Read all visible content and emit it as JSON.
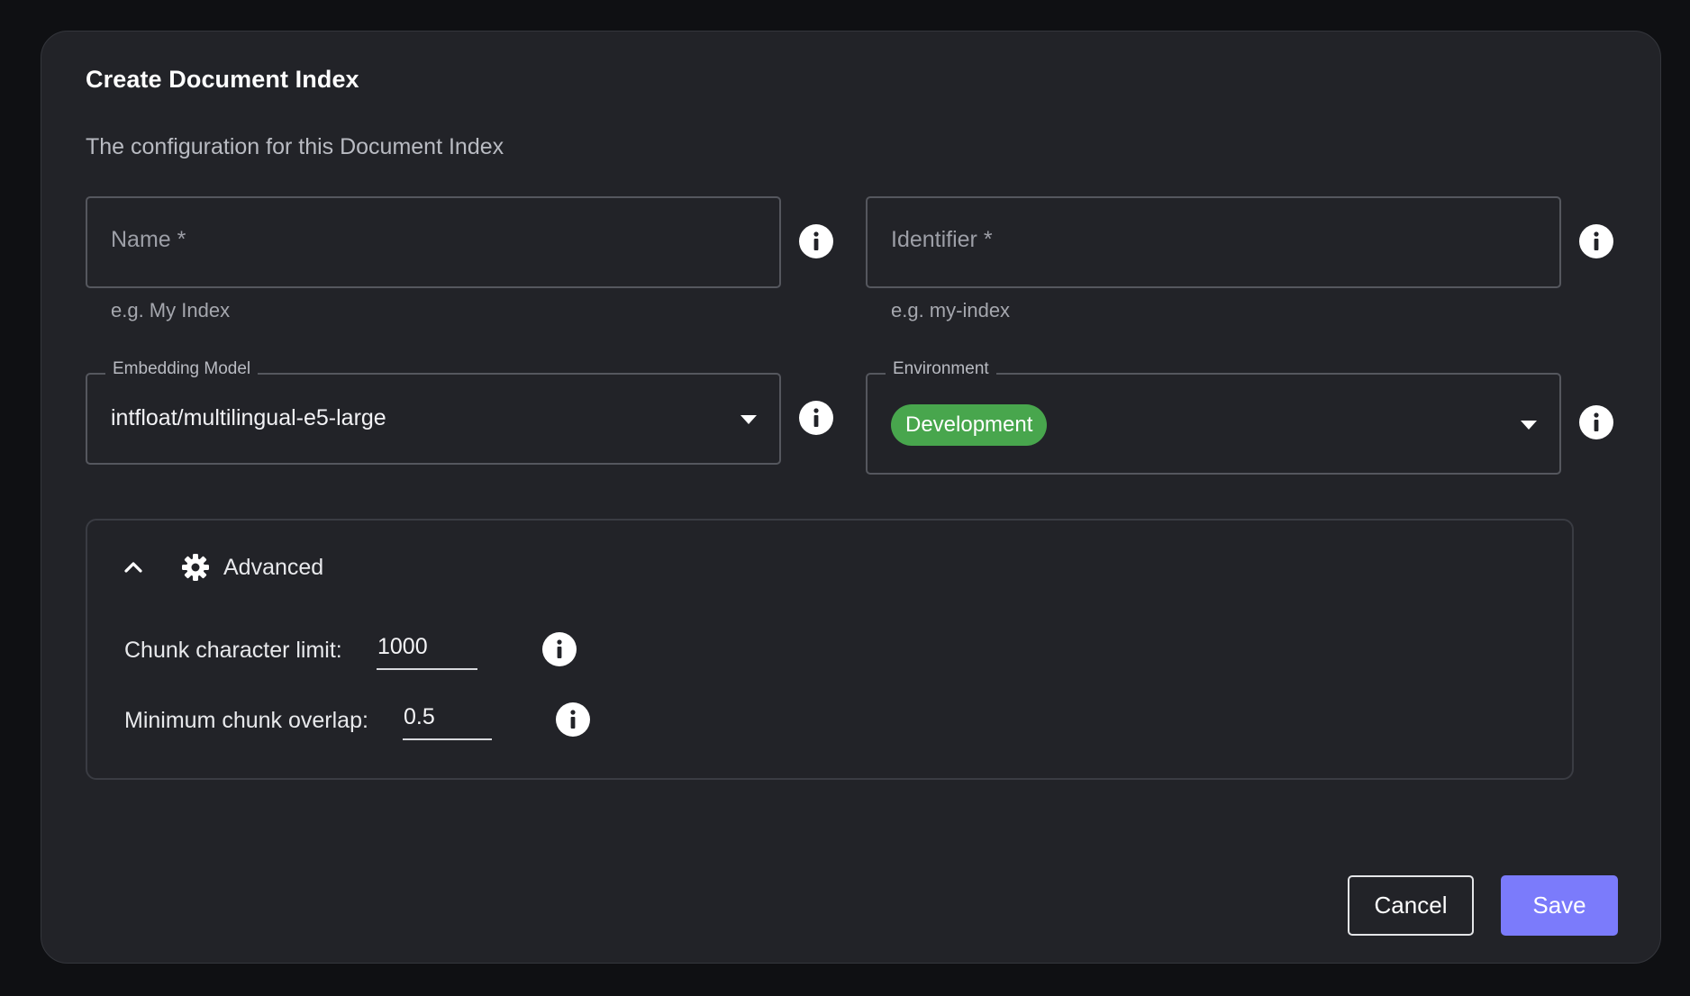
{
  "dialog": {
    "title": "Create Document Index",
    "subtitle": "The configuration for this Document Index"
  },
  "fields": {
    "name": {
      "label": "Name *",
      "value": "",
      "helper": "e.g. My Index"
    },
    "identifier": {
      "label": "Identifier *",
      "value": "",
      "helper": "e.g. my-index"
    },
    "embedding_model": {
      "label": "Embedding Model",
      "value": "intfloat/multilingual-e5-large"
    },
    "environment": {
      "label": "Environment",
      "value": "Development",
      "chip_color": "#48a64d"
    }
  },
  "advanced": {
    "label": "Advanced",
    "expanded": true,
    "chunk_limit": {
      "label": "Chunk character limit:",
      "value": "1000"
    },
    "chunk_overlap": {
      "label": "Minimum chunk overlap:",
      "value": "0.5"
    }
  },
  "actions": {
    "cancel_label": "Cancel",
    "save_label": "Save",
    "accent_color": "#7b7bfb"
  },
  "icons": {
    "info": "info-icon",
    "chevron": "chevron-up-icon",
    "settings": "gear-icon",
    "dropdown": "caret-down-icon"
  }
}
